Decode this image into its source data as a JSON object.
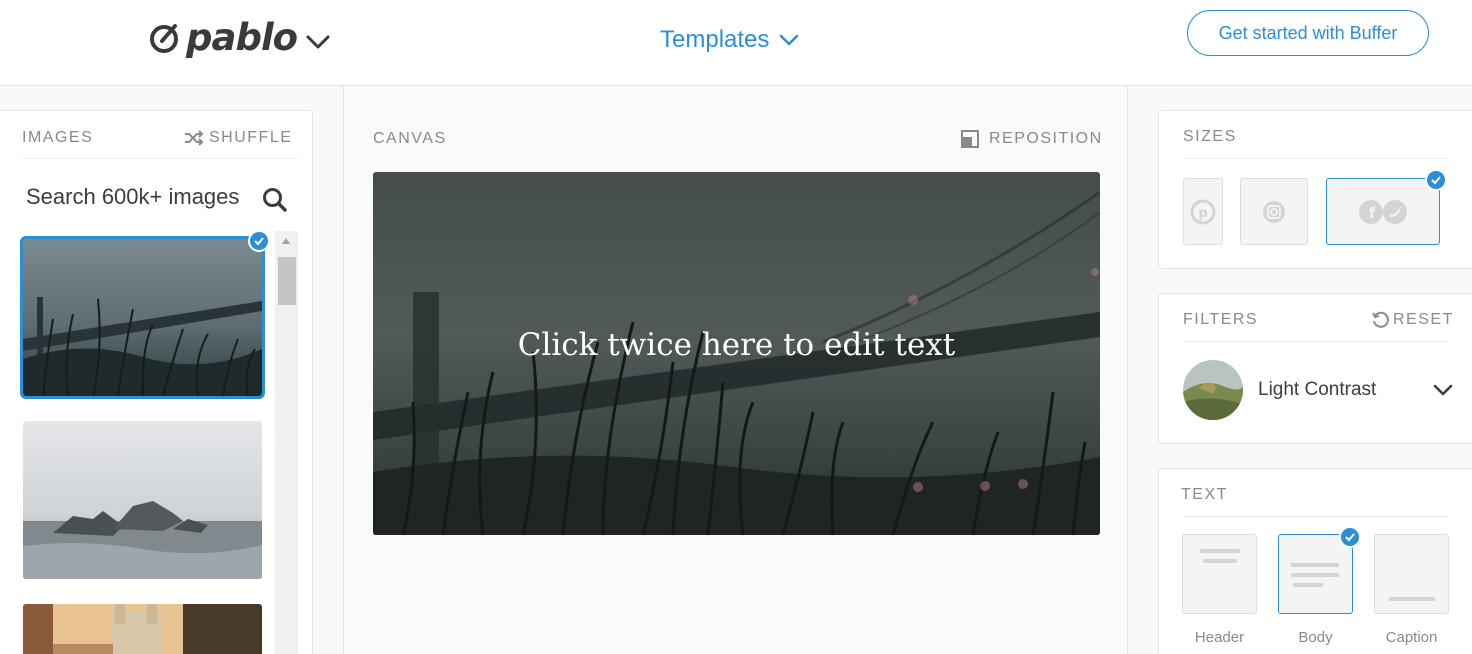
{
  "brand": {
    "name": "pablo"
  },
  "header": {
    "templates_label": "Templates",
    "cta_label": "Get started with Buffer"
  },
  "images_panel": {
    "title": "IMAGES",
    "shuffle_label": "SHUFFLE",
    "search_placeholder": "Search 600k+ images",
    "thumbnails": [
      {
        "subject": "bridge-grass-dusk",
        "selected": true
      },
      {
        "subject": "rocks-sea-fog",
        "selected": false
      },
      {
        "subject": "town-church-sunset",
        "selected": false
      }
    ]
  },
  "canvas": {
    "title": "CANVAS",
    "reposition_label": "REPOSITION",
    "overlay_text": "Click twice here to edit text"
  },
  "sizes_panel": {
    "title": "SIZES",
    "options": [
      {
        "icon": "pinterest-icon",
        "selected": false
      },
      {
        "icon": "instagram-icon",
        "selected": false
      },
      {
        "icon": "facebook-twitter-icon",
        "selected": true
      }
    ]
  },
  "filters_panel": {
    "title": "FILTERS",
    "reset_label": "RESET",
    "selected_filter": "Light Contrast"
  },
  "text_panel": {
    "title": "TEXT",
    "options": [
      {
        "label": "Header",
        "selected": false
      },
      {
        "label": "Body",
        "selected": true
      },
      {
        "label": "Caption",
        "selected": false
      }
    ]
  },
  "colors": {
    "accent": "#2c8ed6",
    "muted_text": "#8a8a8a",
    "border": "#e4e4e4"
  }
}
